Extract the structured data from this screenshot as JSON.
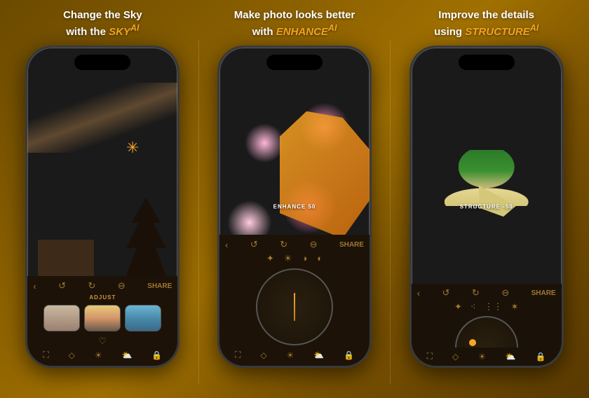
{
  "panels": [
    {
      "id": "sky",
      "title_line1": "Change the Sky",
      "title_line2": "with the ",
      "highlight": "SKY",
      "highlight_sup": "AI",
      "feature_badge": "",
      "toolbar": {
        "share_label": "SHARE",
        "adjust_label": "ADJUST"
      },
      "footer_icons": [
        "crop",
        "wand",
        "sun",
        "cloud",
        "lock"
      ]
    },
    {
      "id": "enhance",
      "title_line1": "Make photo looks better",
      "title_line2": "with ",
      "highlight": "ENHANCE",
      "highlight_sup": "AI",
      "feature_badge": "ENHANCE 50",
      "toolbar": {
        "share_label": "SHARE"
      },
      "footer_icons": [
        "crop",
        "wand",
        "sun",
        "cloud",
        "lock"
      ]
    },
    {
      "id": "structure",
      "title_line1": "Improve the details",
      "title_line2": "using ",
      "highlight": "STRUCTURE",
      "highlight_sup": "AI",
      "feature_badge": "STRUCTURE -50",
      "toolbar": {
        "share_label": "SHARE"
      },
      "footer_icons": [
        "crop",
        "wand",
        "sun",
        "cloud",
        "lock"
      ]
    }
  ],
  "brand_color": "#f5a623",
  "bg_dark": "#1a1208"
}
